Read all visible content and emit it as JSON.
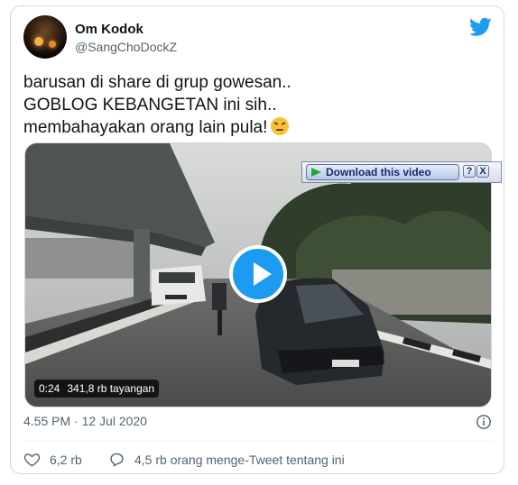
{
  "user": {
    "name": "Om Kodok",
    "handle": "@SangChoDockZ"
  },
  "tweet": {
    "lines": [
      "barusan di share di grup gowesan..",
      "GOBLOG KEBANGETAN ini sih..",
      "membahayakan orang lain pula!"
    ],
    "emoji": "angry-face-emoji"
  },
  "video": {
    "duration": "0:24",
    "views": "341,8 rb tayangan"
  },
  "download_bar": {
    "label": "Download this video",
    "help": "?",
    "close": "X"
  },
  "timestamp": "4.55 PM · 12 Jul 2020",
  "actions": {
    "likes": "6,2 rb",
    "conversation": "4,5 rb orang menge-Tweet tentang ini"
  },
  "colors": {
    "accent": "#1d9bf0",
    "text": "#0f1419",
    "secondary": "#536471"
  },
  "icons": [
    "twitter-bird-icon",
    "play-icon",
    "info-icon",
    "heart-icon",
    "comment-icon",
    "download-arrow-icon"
  ]
}
